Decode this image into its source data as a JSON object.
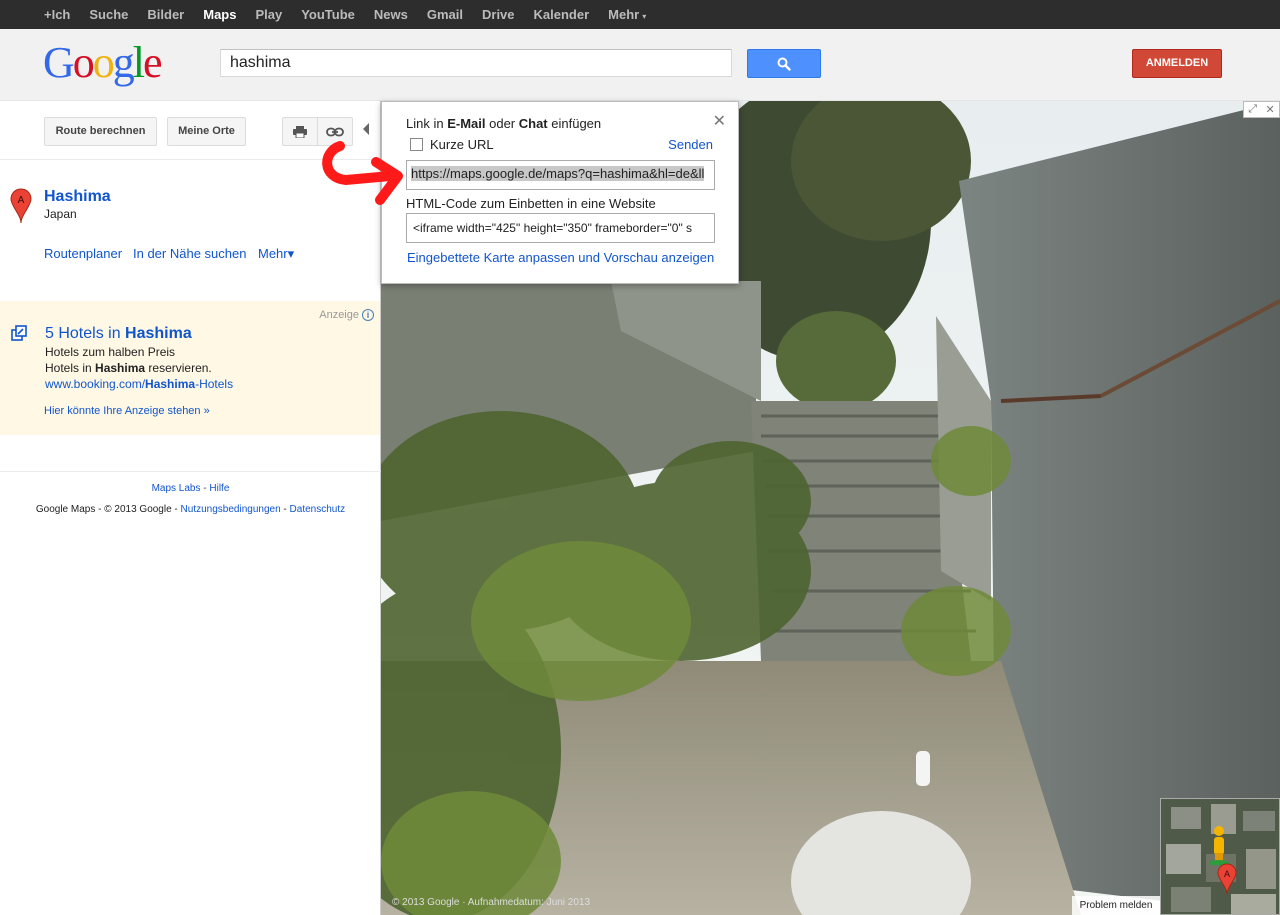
{
  "topnav": {
    "items": [
      {
        "label": "+Ich",
        "active": false
      },
      {
        "label": "Suche",
        "active": false
      },
      {
        "label": "Bilder",
        "active": false
      },
      {
        "label": "Maps",
        "active": true
      },
      {
        "label": "Play",
        "active": false
      },
      {
        "label": "YouTube",
        "active": false
      },
      {
        "label": "News",
        "active": false
      },
      {
        "label": "Gmail",
        "active": false
      },
      {
        "label": "Drive",
        "active": false
      },
      {
        "label": "Kalender",
        "active": false
      },
      {
        "label": "Mehr",
        "active": false
      }
    ],
    "more_caret": "▾"
  },
  "header": {
    "logo_letters": [
      {
        "char": "G",
        "color": "#3369e8"
      },
      {
        "char": "o",
        "color": "#d50f25"
      },
      {
        "char": "o",
        "color": "#eeb211"
      },
      {
        "char": "g",
        "color": "#3369e8"
      },
      {
        "char": "l",
        "color": "#009925"
      },
      {
        "char": "e",
        "color": "#d50f25"
      }
    ],
    "search_value": "hashima",
    "search_icon": "search-icon",
    "signin_label": "ANMELDEN"
  },
  "panel": {
    "route_button": "Route berechnen",
    "places_button": "Meine Orte",
    "print_icon": "print-icon",
    "link_icon": "link-icon",
    "result": {
      "marker_letter": "A",
      "title": "Hashima",
      "subtitle": "Japan",
      "links": [
        "Routenplaner",
        "In der Nähe suchen",
        "Mehr▾"
      ]
    },
    "ad": {
      "label": "Anzeige",
      "info_glyph": "i",
      "title_prefix": "5 Hotels in ",
      "title_bold": "Hashima",
      "line1": "Hotels zum halben Preis",
      "line2_prefix": "Hotels in ",
      "line2_bold": "Hashima",
      "line2_suffix": " reservieren.",
      "url_prefix": "www.booking.com/",
      "url_bold": "Hashima",
      "url_suffix": "-Hotels",
      "more": "Hier könnte Ihre Anzeige stehen »"
    },
    "footer": {
      "labs": "Maps Labs",
      "sep": " - ",
      "help": "Hilfe",
      "copyright": "Google Maps - © 2013 Google - ",
      "terms": "Nutzungsbedingungen",
      "privacy": "Datenschutz"
    }
  },
  "popup": {
    "title_1": "Link in ",
    "title_email": "E-Mail",
    "title_2": " oder ",
    "title_chat": "Chat",
    "title_3": " einfügen",
    "short_url_label": "Kurze URL",
    "send_label": "Senden",
    "url_value": "https://maps.google.de/maps?q=hashima&hl=de&ll",
    "embed_label": "HTML-Code zum Einbetten in eine Website",
    "embed_value": "<iframe width=\"425\" height=\"350\" frameborder=\"0\" s",
    "customize_link": "Eingebettete Karte anpassen und Vorschau anzeigen",
    "close_glyph": "✕"
  },
  "streetview": {
    "copyright": "© 2013 Google · Aufnahmedatum: Juni 2013",
    "report_label": "Problem melden",
    "expand_glyph": "⤢",
    "close_glyph": "✕",
    "minimap_marker": "A"
  }
}
